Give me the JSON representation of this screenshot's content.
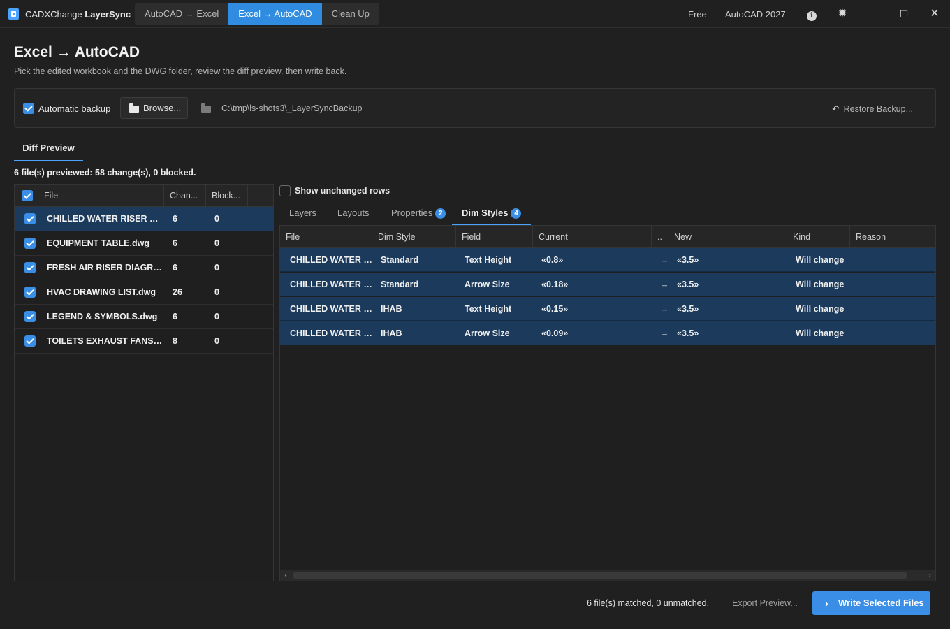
{
  "app": {
    "name_prefix": "CADXChange ",
    "name_bold": "LayerSync",
    "modes": [
      "AutoCAD → Excel",
      "Excel → AutoCAD",
      "Clean Up"
    ],
    "active_mode": 1,
    "license": "Free",
    "autocad_version": "AutoCAD 2027"
  },
  "header": {
    "title": "Excel → AutoCAD",
    "subtitle": "Pick the edited workbook and the DWG folder, review the diff preview, then write back."
  },
  "backup": {
    "auto_label": "Automatic backup",
    "auto_checked": true,
    "browse_label": "Browse...",
    "path": "C:\\tmp\\ls-shots3\\_LayerSyncBackup",
    "restore_label": "Restore Backup..."
  },
  "diff_tab_label": "Diff Preview",
  "summary": "6 file(s) previewed: 58 change(s), 0 blocked.",
  "files": {
    "columns": [
      "File",
      "Chan...",
      "Block..."
    ],
    "rows": [
      {
        "name": "CHILLED WATER RISER DI...",
        "changes": "6",
        "blocked": "0",
        "selected": true
      },
      {
        "name": "EQUIPMENT TABLE.dwg",
        "changes": "6",
        "blocked": "0",
        "selected": false
      },
      {
        "name": "FRESH AIR RISER DIAGRA...",
        "changes": "6",
        "blocked": "0",
        "selected": false
      },
      {
        "name": "HVAC DRAWING LIST.dwg",
        "changes": "26",
        "blocked": "0",
        "selected": false
      },
      {
        "name": "LEGEND & SYMBOLS.dwg",
        "changes": "6",
        "blocked": "0",
        "selected": false
      },
      {
        "name": "TOILETS EXHAUST FANS R...",
        "changes": "8",
        "blocked": "0",
        "selected": false
      }
    ]
  },
  "show_unchanged_label": "Show unchanged rows",
  "sub_tabs": [
    {
      "label": "Layers",
      "badge": ""
    },
    {
      "label": "Layouts",
      "badge": ""
    },
    {
      "label": "Properties",
      "badge": "2"
    },
    {
      "label": "Dim Styles",
      "badge": "4"
    }
  ],
  "active_sub_tab": 3,
  "diff": {
    "columns": [
      "File",
      "Dim Style",
      "Field",
      "Current",
      "..",
      "New",
      "Kind",
      "Reason"
    ],
    "rows": [
      {
        "file": "CHILLED WATER R...",
        "style": "Standard",
        "field": "Text Height",
        "current": "«0.8»",
        "arrow": "→",
        "new": "«3.5»",
        "kind": "Will change",
        "reason": ""
      },
      {
        "file": "CHILLED WATER R...",
        "style": "Standard",
        "field": "Arrow Size",
        "current": "«0.18»",
        "arrow": "→",
        "new": "«3.5»",
        "kind": "Will change",
        "reason": ""
      },
      {
        "file": "CHILLED WATER R...",
        "style": "IHAB",
        "field": "Text Height",
        "current": "«0.15»",
        "arrow": "→",
        "new": "«3.5»",
        "kind": "Will change",
        "reason": ""
      },
      {
        "file": "CHILLED WATER R...",
        "style": "IHAB",
        "field": "Arrow Size",
        "current": "«0.09»",
        "arrow": "→",
        "new": "«3.5»",
        "kind": "Will change",
        "reason": ""
      }
    ]
  },
  "footer": {
    "match_status": "6 file(s) matched, 0 unmatched.",
    "export_label": "Export Preview...",
    "write_label": "Write Selected Files"
  },
  "icons": {
    "info": "info-icon",
    "theme": "sun-icon",
    "minimize": "minimize-icon",
    "maximize": "maximize-icon",
    "close": "close-icon"
  },
  "colors": {
    "accent": "#3a8ee6",
    "selected_row": "#1b3a5c",
    "background": "#202020"
  }
}
